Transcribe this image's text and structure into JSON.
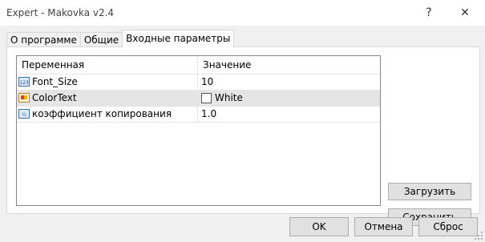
{
  "window": {
    "title": "Expert - Makovka v2.4",
    "help_glyph": "?",
    "close_glyph": "✕"
  },
  "tabs": [
    {
      "label": "О программе",
      "active": false
    },
    {
      "label": "Общие",
      "active": false
    },
    {
      "label": "Входные параметры",
      "active": true
    }
  ],
  "grid": {
    "headers": {
      "variable": "Переменная",
      "value": "Значение"
    },
    "rows": [
      {
        "icon": "numeric-param-icon",
        "name": "Font_Size",
        "value": "10",
        "selected": false
      },
      {
        "icon": "color-param-icon",
        "name": "ColorText",
        "value": "White",
        "selected": true,
        "color": "#ffffff"
      },
      {
        "icon": "fraction-param-icon",
        "name": "коэффициент копирования",
        "value": "1.0",
        "selected": false
      }
    ]
  },
  "side_buttons": {
    "load": "Загрузить",
    "save": "Сохранить"
  },
  "buttons": {
    "ok": "OK",
    "cancel": "Отмена",
    "reset": "Сброс"
  },
  "colors": {
    "selected_row": "#e5e5e5",
    "button_face": "#e1e1e1",
    "dialog_bg": "#f0f0f0"
  }
}
